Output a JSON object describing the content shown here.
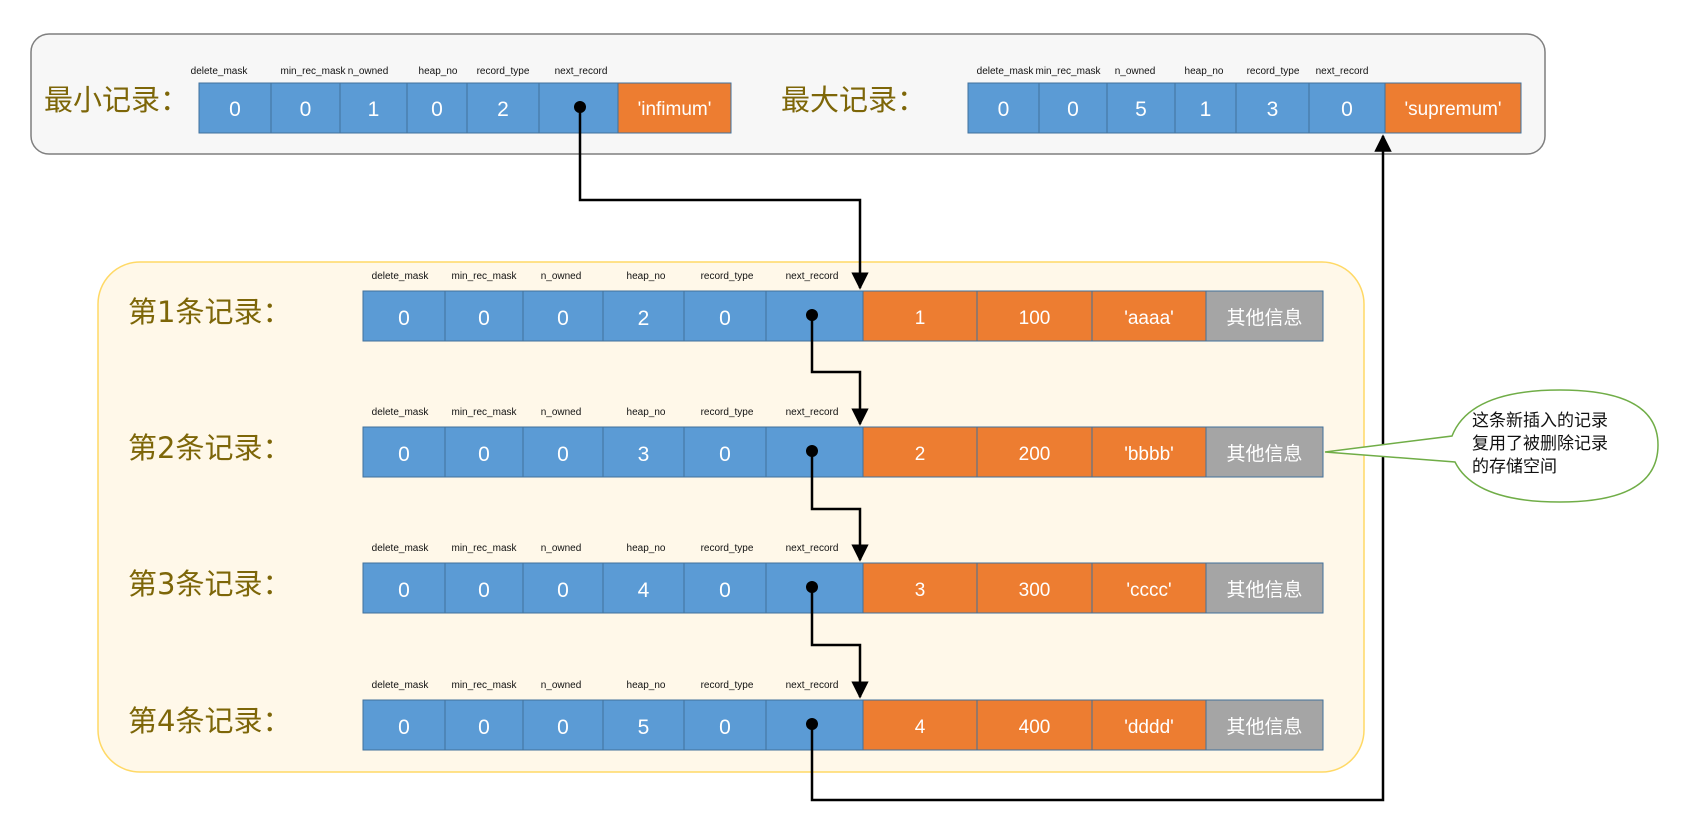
{
  "headers": [
    "delete_mask",
    "min_rec_mask",
    "n_owned",
    "heap_no",
    "record_type",
    "next_record"
  ],
  "min_record": {
    "label": "最小记录：",
    "header": [
      0,
      0,
      1,
      0,
      2
    ],
    "data": "'infimum'"
  },
  "max_record": {
    "label": "最大记录：",
    "header": [
      0,
      0,
      5,
      1,
      3,
      0
    ],
    "data": "'supremum'"
  },
  "records": [
    {
      "label": "第1条记录：",
      "header": [
        0,
        0,
        0,
        2,
        0
      ],
      "data": [
        "1",
        "100",
        "'aaaa'"
      ],
      "other": "其他信息"
    },
    {
      "label": "第2条记录：",
      "header": [
        0,
        0,
        0,
        3,
        0
      ],
      "data": [
        "2",
        "200",
        "'bbbb'"
      ],
      "other": "其他信息"
    },
    {
      "label": "第3条记录：",
      "header": [
        0,
        0,
        0,
        4,
        0
      ],
      "data": [
        "3",
        "300",
        "'cccc'"
      ],
      "other": "其他信息"
    },
    {
      "label": "第4条记录：",
      "header": [
        0,
        0,
        0,
        5,
        0
      ],
      "data": [
        "4",
        "400",
        "'dddd'"
      ],
      "other": "其他信息"
    }
  ],
  "callout": {
    "lines": [
      "这条新插入的记录",
      "复用了被删除记录",
      "的存储空间"
    ]
  },
  "colors": {
    "header_cell": "#5b9bd5",
    "data_cell": "#ed7d31",
    "other_cell": "#a5a5a5",
    "top_panel_bg": "#f7f7f7",
    "records_panel_bg": "#fff8e9",
    "records_panel_border": "#ffd966",
    "callout_border": "#70ad47",
    "label_text": "#7d6608",
    "arrow": "#000000"
  }
}
